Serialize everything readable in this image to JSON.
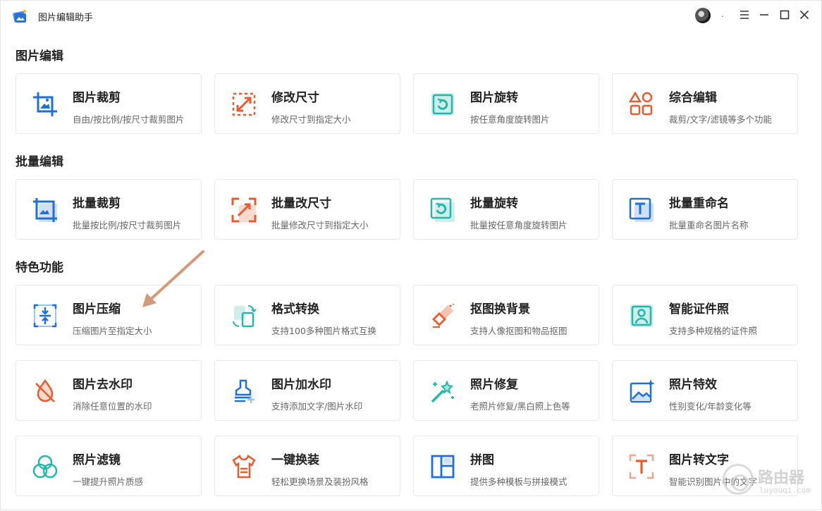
{
  "app": {
    "title": "图片编辑助手",
    "user_label": "."
  },
  "colors": {
    "blue": "#1e6fd9",
    "orange": "#e95a2f",
    "teal": "#21b9ab",
    "arrow": "#d39a7a"
  },
  "sections": [
    {
      "title": "图片编辑"
    },
    {
      "title": "批量编辑"
    },
    {
      "title": "特色功能"
    }
  ],
  "cards": {
    "crop": {
      "title": "图片裁剪",
      "desc": "自由/按比例/按尺寸裁剪图片",
      "icon": "crop-icon"
    },
    "resize": {
      "title": "修改尺寸",
      "desc": "修改尺寸到指定大小",
      "icon": "resize-icon"
    },
    "rotate": {
      "title": "图片旋转",
      "desc": "按任意角度旋转图片",
      "icon": "rotate-icon"
    },
    "combo": {
      "title": "综合编辑",
      "desc": "裁剪/文字/滤镜等多个功能",
      "icon": "shapes-icon"
    },
    "batch_crop": {
      "title": "批量裁剪",
      "desc": "批量按比例/按尺寸裁剪图片",
      "icon": "batch-crop-icon"
    },
    "batch_resize": {
      "title": "批量改尺寸",
      "desc": "批量修改尺寸到指定大小",
      "icon": "batch-resize-icon"
    },
    "batch_rotate": {
      "title": "批量旋转",
      "desc": "批量按任意角度旋转图片",
      "icon": "batch-rotate-icon"
    },
    "batch_rename": {
      "title": "批量重命名",
      "desc": "批量重命名图片名称",
      "icon": "rename-icon"
    },
    "compress": {
      "title": "图片压缩",
      "desc": "压缩图片至指定大小",
      "icon": "compress-icon"
    },
    "convert": {
      "title": "格式转换",
      "desc": "支持100多种图片格式互换",
      "icon": "convert-icon"
    },
    "cutout": {
      "title": "抠图换背景",
      "desc": "支持人像抠图和物品抠图",
      "icon": "eraser-icon"
    },
    "id_photo": {
      "title": "智能证件照",
      "desc": "支持多种规格的证件照",
      "icon": "id-photo-icon"
    },
    "remove_wm": {
      "title": "图片去水印",
      "desc": "消除任意位置的水印",
      "icon": "no-drop-icon"
    },
    "add_wm": {
      "title": "图片加水印",
      "desc": "支持添加文字/图片水印",
      "icon": "stamp-icon"
    },
    "restore": {
      "title": "照片修复",
      "desc": "老照片修复/黑白照上色等",
      "icon": "magic-wand-icon"
    },
    "effects": {
      "title": "照片特效",
      "desc": "性别变化/年龄变化等",
      "icon": "sparkle-image-icon"
    },
    "filter": {
      "title": "照片滤镜",
      "desc": "一键提升照片质感",
      "icon": "filter-icon"
    },
    "outfit": {
      "title": "一键换装",
      "desc": "轻松更换场景及装扮风格",
      "icon": "shirt-icon"
    },
    "collage": {
      "title": "拼图",
      "desc": "提供多种模板与拼接模式",
      "icon": "collage-icon"
    },
    "ocr": {
      "title": "图片转文字",
      "desc": "智能识别图片中的文字",
      "icon": "ocr-icon"
    }
  },
  "watermark": {
    "text": "路由器",
    "sub": "luyouqi.com"
  }
}
